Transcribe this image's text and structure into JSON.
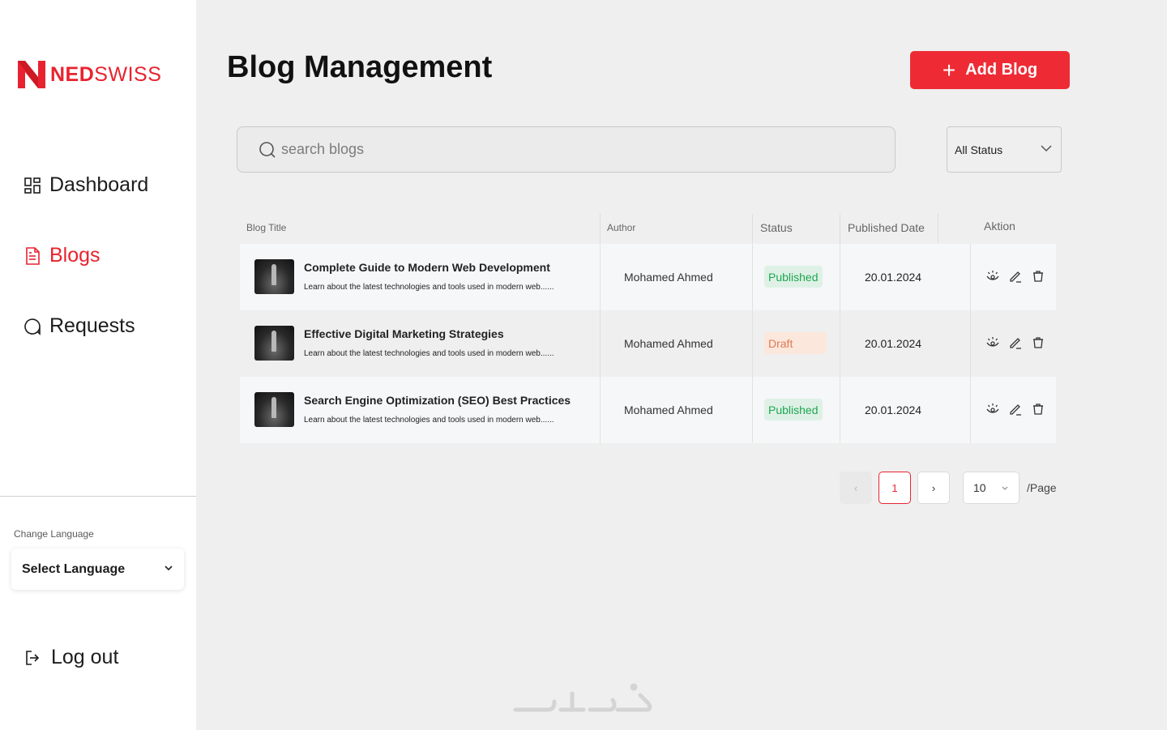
{
  "brand": {
    "name_bold": "NED",
    "name_light": "SWISS",
    "accent": "#e8232f"
  },
  "sidebar": {
    "items": [
      {
        "label": "Dashboard",
        "icon": "grid-icon",
        "active": false
      },
      {
        "label": "Blogs",
        "icon": "document-icon",
        "active": true
      },
      {
        "label": "Requests",
        "icon": "chat-bubble-icon",
        "active": false
      }
    ],
    "language_label": "Change Language",
    "language_select": "Select Language",
    "logout_label": "Log out"
  },
  "header": {
    "title": "Blog Management",
    "add_button": "Add Blog"
  },
  "filters": {
    "search_placeholder": "search blogs",
    "status_value": "All Status"
  },
  "table": {
    "columns": [
      "Blog Title",
      "Author",
      "Status",
      "Published Date",
      "Aktion"
    ],
    "rows": [
      {
        "title": "Complete Guide to Modern Web Development",
        "desc": "Learn about the latest technologies and tools used in modern web......",
        "author": "Mohamed Ahmed",
        "status": "Published",
        "date": "20.01.2024"
      },
      {
        "title": "Effective Digital Marketing Strategies",
        "desc": "Learn about the latest technologies and tools used in modern web......",
        "author": "Mohamed Ahmed",
        "status": "Draft",
        "date": "20.01.2024"
      },
      {
        "title": "Search Engine Optimization (SEO) Best Practices",
        "desc": "Learn about the latest technologies and tools used in modern web......",
        "author": "Mohamed Ahmed",
        "status": "Published",
        "date": "20.01.2024"
      }
    ]
  },
  "pagination": {
    "prev": "‹",
    "current": "1",
    "next": "›",
    "page_size": "10",
    "per_page_label": "/Page"
  },
  "colors": {
    "published_text": "#1ea752",
    "published_bg": "#dff1e6",
    "draft_text": "#e07a55",
    "draft_bg": "#fbe7dc"
  }
}
